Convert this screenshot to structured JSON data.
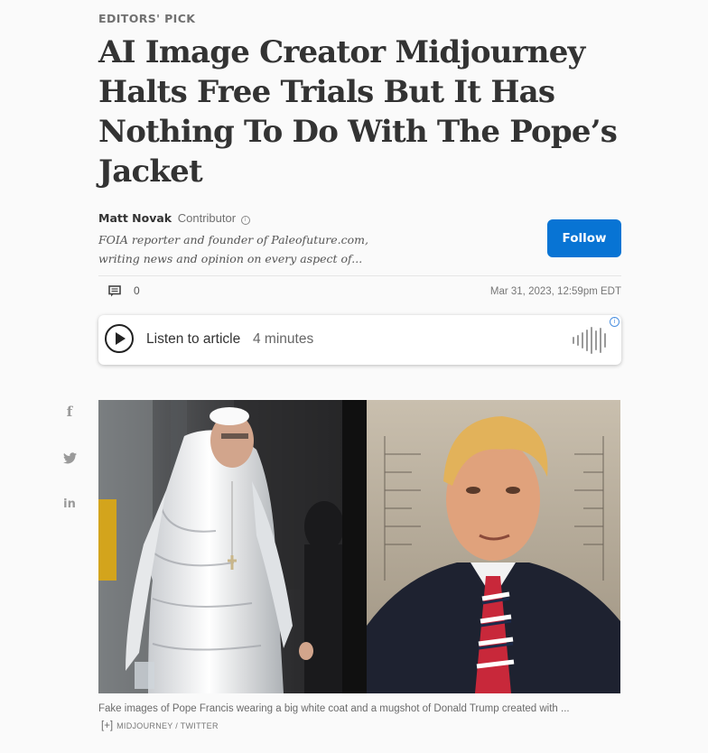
{
  "article": {
    "kicker": "EDITORS' PICK",
    "headline": "AI Image Creator Midjourney Halts Free Trials But It Has Nothing To Do With The Pope’s Jacket"
  },
  "author": {
    "name": "Matt Novak",
    "role": "Contributor",
    "bio": "FOIA reporter and founder of Paleofuture.com, writing news and opinion on every aspect of...",
    "follow_label": "Follow"
  },
  "meta": {
    "comment_count": "0",
    "date": "Mar 31, 2023, 12:59pm EDT"
  },
  "listen": {
    "label": "Listen to article",
    "duration": "4 minutes"
  },
  "share": {
    "items": [
      "facebook-icon",
      "twitter-icon",
      "linkedin-icon"
    ]
  },
  "image": {
    "caption": "Fake images of Pope Francis wearing a big white coat and a mugshot of Donald Trump created with ...",
    "expand_label": "[+]",
    "credit": "MIDJOURNEY / TWITTER"
  },
  "colors": {
    "accent": "#0874d4",
    "text": "#333333",
    "muted": "#707070"
  }
}
